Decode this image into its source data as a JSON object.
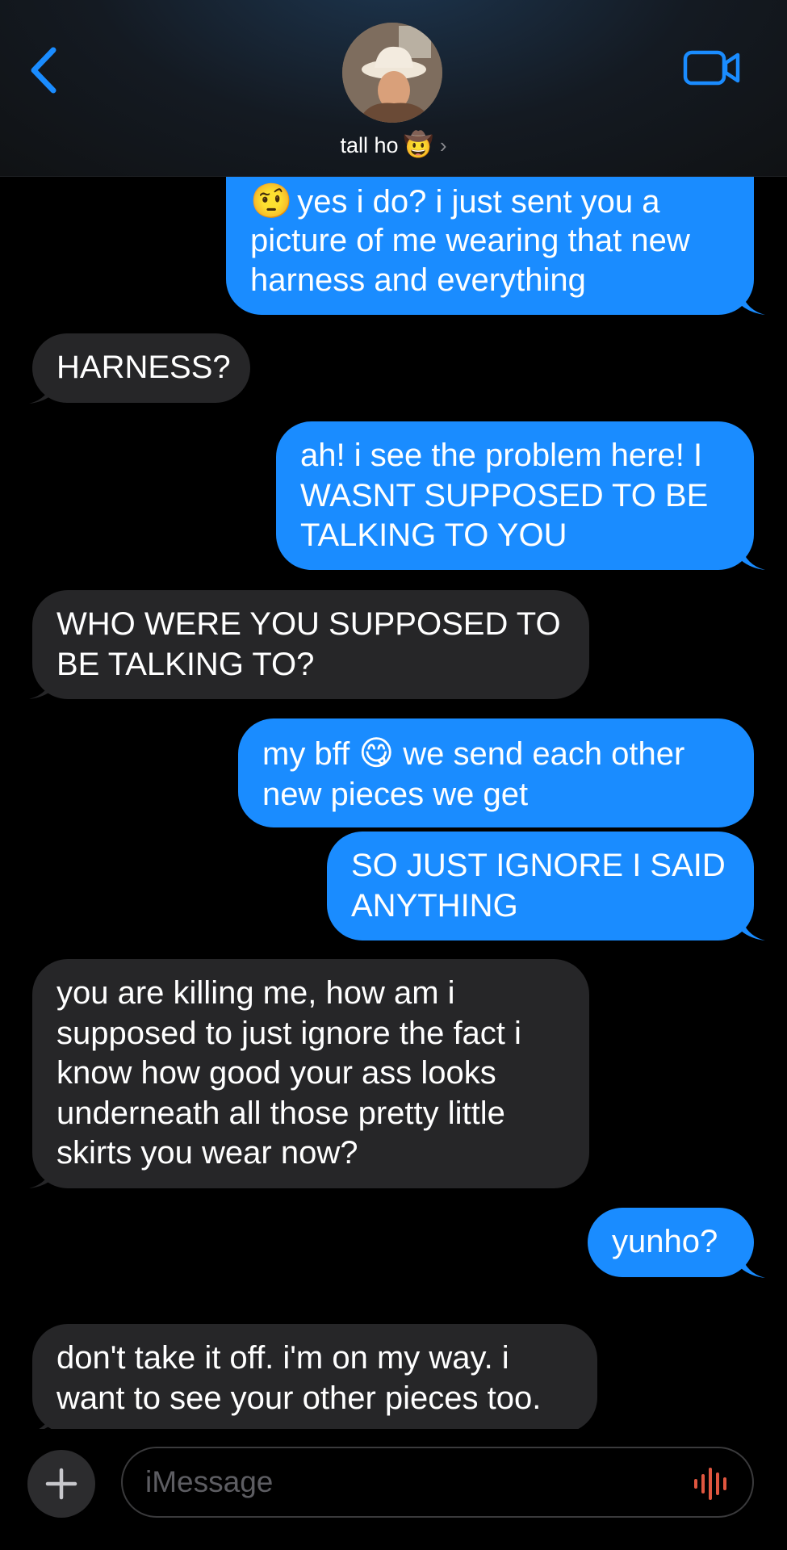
{
  "header": {
    "contact_name": "tall ho",
    "contact_emoji": "🤠",
    "chevron": "›",
    "icons": {
      "back": "chevron-left-icon",
      "video": "video-camera-icon"
    },
    "accent_color": "#1a8cff"
  },
  "messages": [
    {
      "direction": "outgoing",
      "emoji": "🤨",
      "text": "yes i do? i just sent you a",
      "text_cont": [
        "picture of me wearing that new",
        "harness and everything"
      ]
    },
    {
      "direction": "incoming",
      "text": "HARNESS?"
    },
    {
      "direction": "outgoing",
      "lines": [
        "ah! i see the problem here! I",
        "WASNT SUPPOSED TO BE",
        "TALKING TO YOU"
      ]
    },
    {
      "direction": "incoming",
      "lines": [
        "WHO WERE YOU SUPPOSED TO",
        "BE TALKING TO?"
      ]
    },
    {
      "direction": "outgoing",
      "before": "my bff",
      "emoji": "😋",
      "after": "we send each other",
      "line2": "new pieces we get"
    },
    {
      "direction": "outgoing",
      "lines": [
        "SO JUST IGNORE I SAID",
        "ANYTHING"
      ]
    },
    {
      "direction": "incoming",
      "lines": [
        "you are killing me, how am i",
        "supposed to just ignore the fact i",
        "know how good your ass looks",
        "underneath all those pretty little",
        "skirts you wear now?"
      ]
    },
    {
      "direction": "outgoing",
      "text": "yunho?"
    },
    {
      "direction": "incoming",
      "lines": [
        "don't take it off. i'm on my way. i",
        "want to see your other pieces too."
      ]
    }
  ],
  "composer": {
    "placeholder": "iMessage",
    "plus_label": "+",
    "icons": {
      "add": "plus-icon",
      "voice": "waveform-icon"
    },
    "voice_color": "#e0563f"
  }
}
